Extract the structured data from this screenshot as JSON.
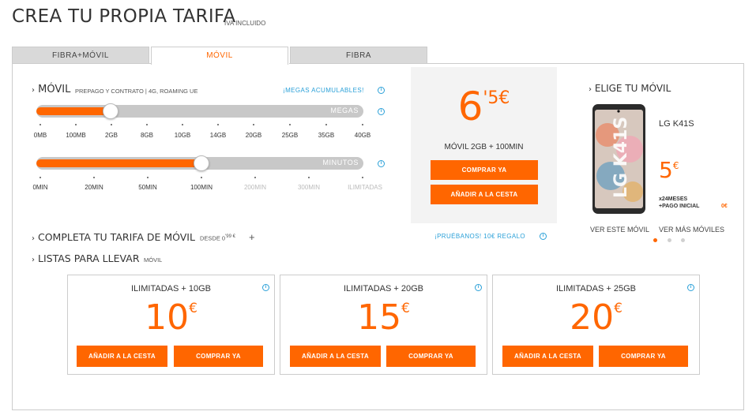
{
  "page": {
    "title": "CREA TU PROPIA TARIFA",
    "subtitle": "IVA INCLUIDO"
  },
  "tabs": [
    {
      "label": "FIBRA+MÓVIL",
      "active": false
    },
    {
      "label": "MÓVIL",
      "active": true
    },
    {
      "label": "FIBRA",
      "active": false
    }
  ],
  "movil": {
    "heading": "MÓVIL",
    "desc": "PREPAGO Y CONTRATO | 4G, ROAMING UE",
    "megas_link": "¡MEGAS ACUMULABLES!",
    "megas_slider": {
      "label": "MEGAS",
      "selected": "2GB",
      "ticks": [
        "0MB",
        "100MB",
        "2GB",
        "8GB",
        "10GB",
        "14GB",
        "20GB",
        "25GB",
        "35GB",
        "40GB"
      ]
    },
    "minutos_slider": {
      "label": "MINUTOS",
      "selected": "100MIN",
      "ticks": [
        "0MIN",
        "20MIN",
        "50MIN",
        "100MIN",
        "200MIN",
        "300MIN",
        "ILIMITADAS"
      ]
    }
  },
  "price_box": {
    "int": "6",
    "dec": "'5€",
    "desc": "MÓVIL 2GB + 100MIN",
    "buy_label": "COMPRAR YA",
    "cart_label": "AÑADIR A LA CESTA"
  },
  "complete": {
    "heading": "COMPLETA TU TARIFA DE MÓVIL",
    "from": "DESDE 0",
    "from_sup": "'99 €",
    "plus": "+",
    "promo": "¡PRUÉBANOS! 10€ REGALO"
  },
  "listas": {
    "heading": "LISTAS PARA LLEVAR",
    "sub": "MÓVIL"
  },
  "cards": [
    {
      "title": "ILIMITADAS + 10GB",
      "price": "10",
      "euro": "€",
      "cart_label": "AÑADIR A LA CESTA",
      "buy_label": "COMPRAR YA"
    },
    {
      "title": "ILIMITADAS + 20GB",
      "price": "15",
      "euro": "€",
      "cart_label": "AÑADIR A LA CESTA",
      "buy_label": "COMPRAR YA"
    },
    {
      "title": "ILIMITADAS + 25GB",
      "price": "20",
      "euro": "€",
      "cart_label": "AÑADIR A LA CESTA",
      "buy_label": "COMPRAR YA"
    }
  ],
  "phone": {
    "heading": "ELIGE TU MÓVIL",
    "name": "LG K41S",
    "screen_text": "LG K41S",
    "price": "5",
    "price_euro": "€",
    "months": "x24MESES",
    "initial": "+PAGO INICIAL",
    "initial_value": "0€",
    "view_link": "VER ESTE MÓVIL",
    "more_link": "VER MÁS MÓVILES"
  },
  "colors": {
    "accent": "#ff6600",
    "link": "#2aa0d8",
    "tab_bg": "#d9d9d9",
    "box_bg": "#f3f3f3"
  }
}
